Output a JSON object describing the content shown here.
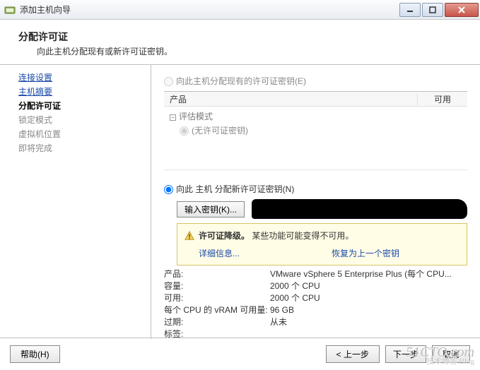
{
  "window": {
    "title": "添加主机向导"
  },
  "header": {
    "title": "分配许可证",
    "subtitle": "向此主机分配现有或新许可证密钥。"
  },
  "sidebar": {
    "steps": [
      {
        "label": "连接设置",
        "state": "done"
      },
      {
        "label": "主机摘要",
        "state": "done"
      },
      {
        "label": "分配许可证",
        "state": "current"
      },
      {
        "label": "锁定模式",
        "state": "todo"
      },
      {
        "label": "虚拟机位置",
        "state": "todo"
      },
      {
        "label": "即将完成",
        "state": "todo"
      }
    ]
  },
  "main": {
    "radio_existing": "向此主机分配现有的许可证密钥(E)",
    "tree": {
      "col_product": "产品",
      "col_available": "可用",
      "group": "评估模式",
      "item": "(无许可证密钥)"
    },
    "radio_new": "向此 主机 分配新许可证密钥(N)",
    "enter_key_btn": "输入密钥(K)...",
    "warning": {
      "title": "许可证降级。",
      "text": "某些功能可能变得不可用。",
      "detail": "详细信息...",
      "restore": "恢复为上一个密钥"
    },
    "kv": {
      "product_k": "产品:",
      "product_v": "VMware vSphere 5 Enterprise Plus (每个 CPU...",
      "capacity_k": "容量:",
      "capacity_v": "2000 个 CPU",
      "available_k": "可用:",
      "available_v": "2000 个 CPU",
      "vram_k": "每个 CPU 的 vRAM 可用量:",
      "vram_v": "96 GB",
      "expires_k": "过期:",
      "expires_v": "从未",
      "tags_k": "标签:",
      "tags_v": ""
    }
  },
  "footer": {
    "help": "帮助(H)",
    "back": "< 上一步",
    "next": "下一步",
    "cancel": "取消"
  },
  "watermark": {
    "line1": "51CTO.com",
    "line2": "技术博客 Blog"
  }
}
